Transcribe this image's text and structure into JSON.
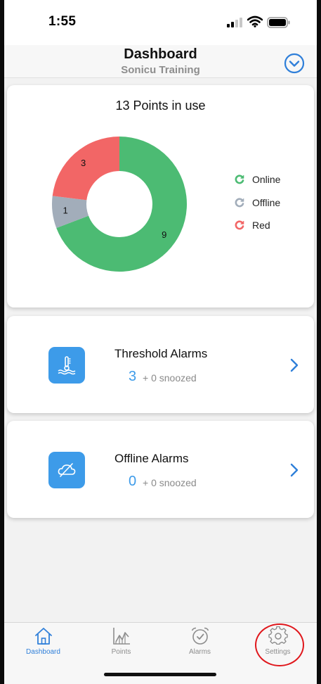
{
  "status_bar": {
    "time": "1:55"
  },
  "header": {
    "title": "Dashboard",
    "subtitle": "Sonicu Training"
  },
  "points_card": {
    "title": "13 Points in use",
    "legend": [
      {
        "label": "Online",
        "color": "#4cbb73",
        "icon": "online-refresh-icon"
      },
      {
        "label": "Offline",
        "color": "#a2adba",
        "icon": "offline-refresh-icon"
      },
      {
        "label": "Red",
        "color": "#f26666",
        "icon": "red-refresh-icon"
      }
    ]
  },
  "chart_data": {
    "type": "pie",
    "style": "donut",
    "categories": [
      "Online",
      "Offline",
      "Red"
    ],
    "values": [
      9,
      1,
      3
    ],
    "colors": [
      "#4cbb73",
      "#a2adba",
      "#f26666"
    ],
    "title": "13 Points in use",
    "legend_placement": "right"
  },
  "threshold_alarms": {
    "title": "Threshold Alarms",
    "count": "3",
    "snoozed": "+ 0 snoozed",
    "icon": "thermometer-water-icon"
  },
  "offline_alarms": {
    "title": "Offline Alarms",
    "count": "0",
    "snoozed": "+ 0 snoozed",
    "icon": "cloud-offline-icon"
  },
  "tabs": [
    {
      "label": "Dashboard",
      "icon": "home-icon",
      "active": true
    },
    {
      "label": "Points",
      "icon": "chart-icon",
      "active": false
    },
    {
      "label": "Alarms",
      "icon": "alarm-clock-icon",
      "active": false
    },
    {
      "label": "Settings",
      "icon": "gear-icon",
      "active": false
    }
  ],
  "colors": {
    "accent": "#3d9be9",
    "tab_active": "#2f7fd9",
    "highlight": "#e0171c"
  }
}
